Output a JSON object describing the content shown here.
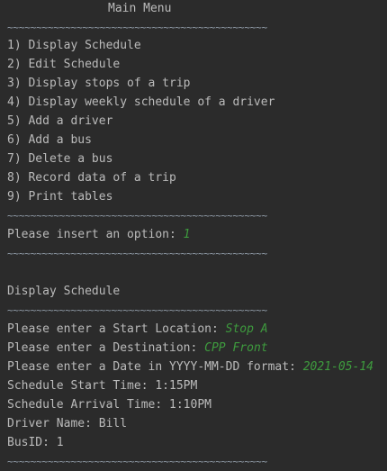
{
  "console": {
    "menu_title": "Main Menu",
    "separator": "~~~~~~~~~~~~~~~~~~~~~~~~~~~~~~~~~~~~~~~~~~~~~",
    "menu_items": [
      "1) Display Schedule",
      "2) Edit Schedule",
      "3) Display stops of a trip",
      "4) Display weekly schedule of a driver",
      "5) Add a driver",
      "6) Add a bus",
      "7) Delete a bus",
      "8) Record data of a trip",
      "9) Print tables"
    ],
    "option_prompt": "Please insert an option: ",
    "option_value": "1",
    "section_title": "Display Schedule",
    "start_prompt": "Please enter a Start Location: ",
    "start_value": "Stop A",
    "dest_prompt": "Please enter a Destination: ",
    "dest_value": "CPP Front",
    "date_prompt": "Please enter a Date in YYYY-MM-DD format: ",
    "date_value": "2021-05-14",
    "start_time": "Schedule Start Time: 1:15PM",
    "arrival_time": "Schedule Arrival Time: 1:10PM",
    "driver_name": "Driver Name: Bill",
    "bus_id": "BusID: 1"
  },
  "colors": {
    "background": "#2b2b2b",
    "text": "#bbbbbb",
    "user_input": "#3e9b3e"
  }
}
